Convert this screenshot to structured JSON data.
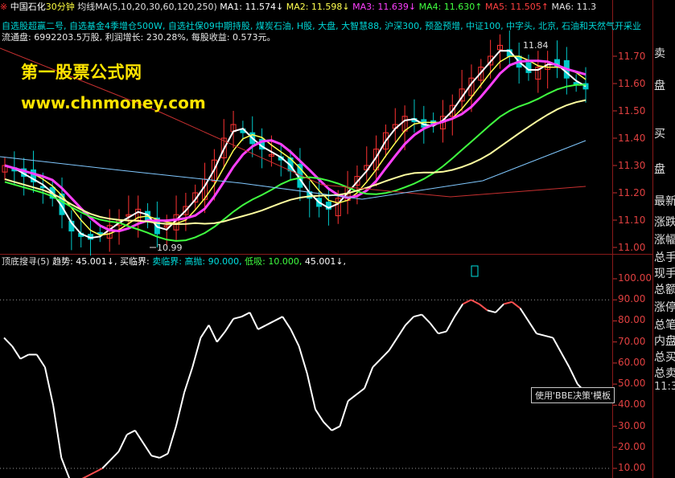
{
  "header": {
    "symbol_glyph": "※",
    "stock_name": "中国石化",
    "period": "30分钟",
    "ma_label": "均线MA(5,10,20,30,60,120,250)",
    "ma1": "MA1: 11.574↓",
    "ma2": "MA2: 11.598↓",
    "ma3": "MA3: 11.639↓",
    "ma4": "MA4: 11.630↑",
    "ma5": "MA5: 11.505↑",
    "ma6": "MA6: 11.3"
  },
  "tags_line": "自选股超赢二号, 自选基金4季增仓500W, 自选社保09中期持股, 煤炭石油, H股, 大盘, 大智慧88, 沪深300, 预盈预增, 中证100, 中字头, 北京, 石油和天然气开采业",
  "info_line": "流通盘: 6992203.5万股, 利润增长: 230.28%, 每股收益: 0.573元。",
  "watermark": {
    "line1": "第一股票公式网",
    "line2": "www.chnmoney.com"
  },
  "indicator": {
    "name": "顶底搜寻(5)",
    "trend": "趋势: 45.001↓,",
    "buy": "买临界:",
    "sell": "卖临界:",
    "high": "高抛: 90.000,",
    "low": "低吸: 10.000,",
    "value": "45.001↓,"
  },
  "tooltip": "使用'BBE决策'模板",
  "price_axis": [
    "11.70",
    "11.60",
    "11.50",
    "11.40",
    "11.30",
    "11.20",
    "11.10",
    "11.00"
  ],
  "ind_axis": [
    "100.00",
    "90.00",
    "80.00",
    "70.00",
    "60.00",
    "50.00",
    "40.00",
    "30.00",
    "20.00",
    "10.00"
  ],
  "price_marks": {
    "high": "11.84",
    "low": "10.99"
  },
  "right_panel": [
    "卖",
    "盘",
    "买",
    "盘",
    "最新",
    "涨跌",
    "涨幅",
    "总手",
    "现手",
    "总额",
    "涨停",
    "总笔",
    "内盘",
    "总买",
    "总卖",
    "11:3"
  ],
  "colors": {
    "up": "#ff3232",
    "down": "#00c8c8",
    "ma1": "#ffffff",
    "ma2": "#ffff50",
    "ma3": "#ff40ff",
    "ma4": "#40ff40",
    "ma5": "#ffff80",
    "ma6": "#c83030"
  },
  "chart_data": {
    "type": "line",
    "title": "顶底搜寻(5)",
    "ylim": [
      5,
      105
    ],
    "series": [
      {
        "values": [
          72,
          68,
          62,
          64,
          64,
          58,
          40,
          15,
          5,
          4,
          6,
          8,
          10,
          14,
          18,
          26,
          28,
          22,
          16,
          15,
          17,
          30,
          46,
          58,
          72,
          78,
          70,
          75,
          81,
          82,
          84,
          76,
          78,
          80,
          82,
          76,
          68,
          55,
          38,
          32,
          28,
          30,
          42,
          45,
          48,
          58,
          62,
          66,
          72,
          78,
          82,
          83,
          79,
          74,
          75,
          82,
          88,
          90,
          88,
          85,
          84,
          88,
          89,
          86,
          80,
          74,
          73,
          72,
          65,
          58,
          50,
          46
        ]
      }
    ]
  }
}
